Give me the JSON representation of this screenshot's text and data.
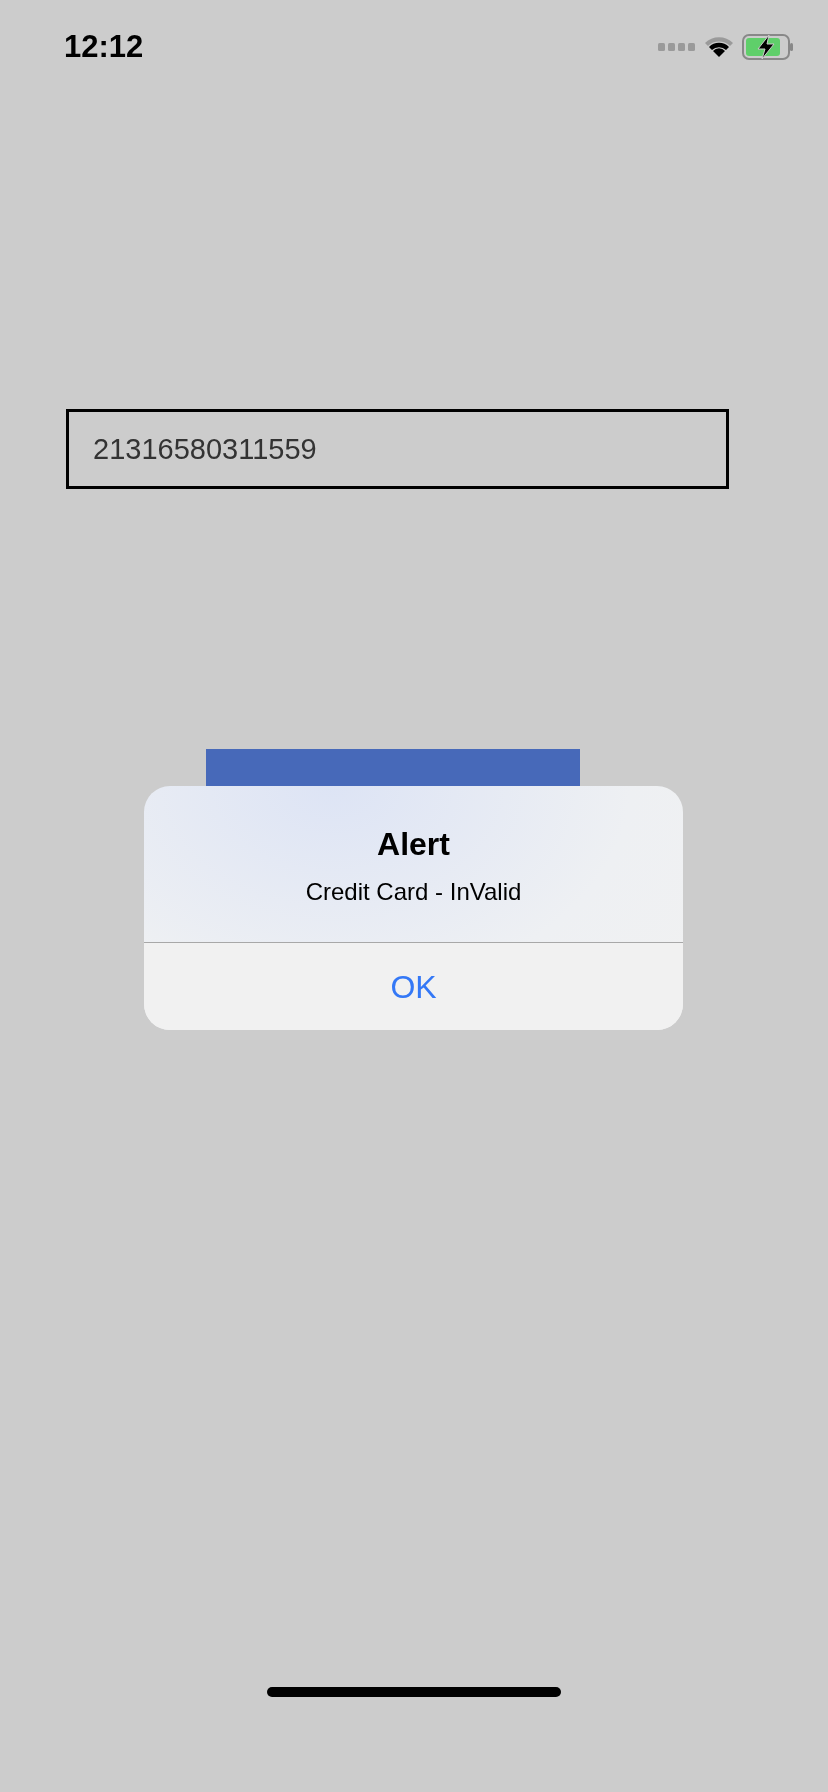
{
  "status_bar": {
    "time": "12:12"
  },
  "card_field": {
    "value": "21316580311559"
  },
  "alert": {
    "title": "Alert",
    "message": "Credit Card - InValid",
    "buttons": [
      "OK"
    ]
  }
}
